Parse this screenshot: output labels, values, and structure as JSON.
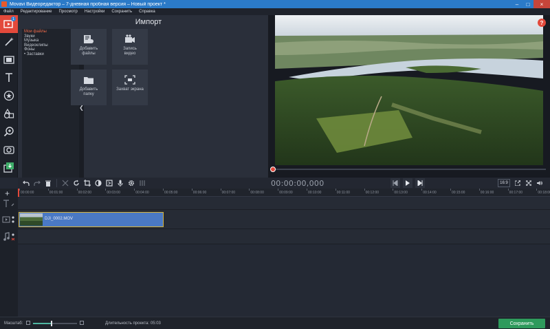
{
  "window": {
    "title": "Movavi Видеоредактор – 7-дневная пробная версия – Новый проект *",
    "min": "–",
    "max": "□",
    "close": "×"
  },
  "menu": [
    "Файл",
    "Редактирование",
    "Просмотр",
    "Настройки",
    "Сохранить",
    "Справка"
  ],
  "tools": {
    "badge": "1",
    "items": [
      "import-icon",
      "magic-wand-icon",
      "filters-icon",
      "titles-icon",
      "stickers-icon",
      "shapes-icon",
      "zoom-icon",
      "camera-icon",
      "export-icon"
    ]
  },
  "import": {
    "title": "Импорт",
    "categories": [
      "Мои файлы",
      "Звуки",
      "Музыка",
      "Видеоклипы",
      "Фоны",
      "• Заставки"
    ],
    "active_category": "Мои файлы",
    "collapse": "❮",
    "tiles": [
      {
        "label1": "Добавить",
        "label2": "файлы"
      },
      {
        "label1": "Запись",
        "label2": "видео"
      },
      {
        "label1": "Добавить",
        "label2": "папку"
      },
      {
        "label1": "Захват экрана",
        "label2": ""
      }
    ]
  },
  "preview": {
    "help": "?",
    "timecode": "00:00:00,000",
    "aspect": "16:9",
    "progress": 0.0
  },
  "timeline": {
    "add": "+",
    "ticks": [
      "00:00:00",
      "00:01:00",
      "00:02:00",
      "00:03:00",
      "00:04:00",
      "00:05:00",
      "00:06:00",
      "00:07:00",
      "00:08:00",
      "00:09:00",
      "00:10:00",
      "00:11:00",
      "00:12:00",
      "00:13:00",
      "00:14:00",
      "00:15:00",
      "00:16:00",
      "00:17:00",
      "00:18:00"
    ],
    "clip_name": "DJI_0002.MOV"
  },
  "status": {
    "zoom_label": "Масштаб:",
    "zoom_level": 0.42,
    "duration_label": "Длительность проекта:",
    "duration_value": "05:03",
    "save_label": "Сохранить"
  },
  "colors": {
    "accent": "#e3493b",
    "save": "#2e9a5c",
    "clip": "#4a79c4",
    "titlebar": "#2b7ac8"
  }
}
